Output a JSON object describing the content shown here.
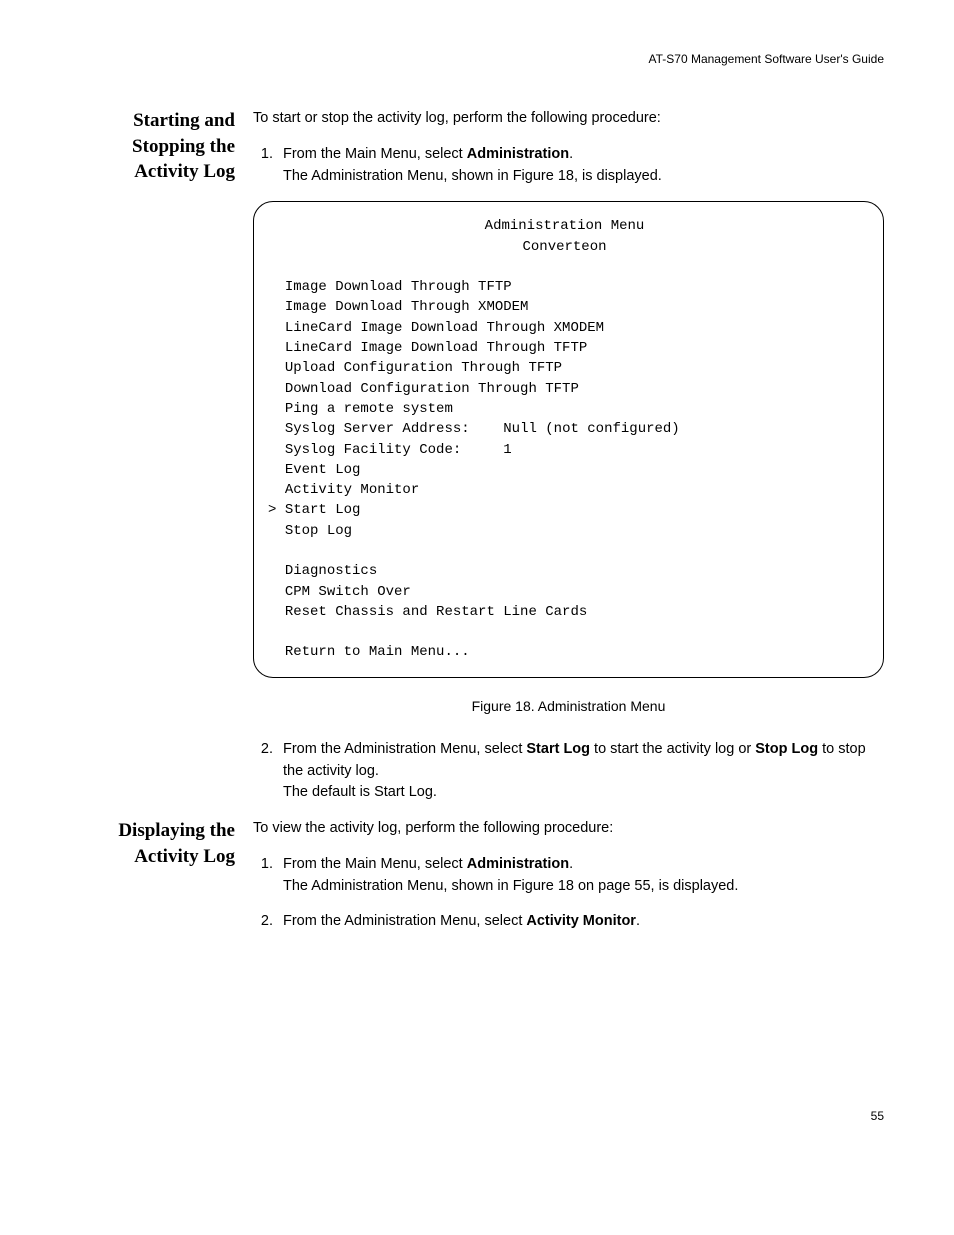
{
  "header": {
    "guide_title": "AT-S70 Management Software User's Guide"
  },
  "section1": {
    "heading": "Starting and Stopping the Activity Log",
    "intro": "To start or stop the activity log, perform the following procedure:",
    "step1_pre": "From the Main Menu, select ",
    "step1_bold": "Administration",
    "step1_post": ".",
    "step1_after": "The Administration Menu, shown in Figure 18, is displayed.",
    "step2_pre": "From the Administration Menu, select ",
    "step2_bold1": "Start Log",
    "step2_mid": " to start the activity log or ",
    "step2_bold2": "Stop Log",
    "step2_post": " to stop the activity log.",
    "step2_after": "The default is Start Log."
  },
  "menu": {
    "title_line1": "Administration Menu",
    "title_line2": "Converteon",
    "item1": "Image Download Through TFTP",
    "item2": "Image Download Through XMODEM",
    "item3": "LineCard Image Download Through XMODEM",
    "item4": "LineCard Image Download Through TFTP",
    "item5": "Upload Configuration Through TFTP",
    "item6": "Download Configuration Through TFTP",
    "item7": "Ping a remote system",
    "item8_label": "Syslog Server Address:",
    "item8_value": "Null (not configured)",
    "item9_label": "Syslog Facility Code:",
    "item9_value": "1",
    "item10": "Event Log",
    "item11": "Activity Monitor",
    "item12": "Start Log",
    "item13": "Stop Log",
    "item14": "Diagnostics",
    "item15": "CPM Switch Over",
    "item16": "Reset Chassis and Restart Line Cards",
    "item17": "Return to Main Menu...",
    "cursor": ">"
  },
  "figure_caption": "Figure 18. Administration Menu",
  "section2": {
    "heading": "Displaying the Activity Log",
    "intro": "To view the activity log, perform the following procedure:",
    "step1_pre": "From the Main Menu, select ",
    "step1_bold": "Administration",
    "step1_post": ".",
    "step1_after": "The Administration Menu, shown in Figure 18 on page 55, is displayed.",
    "step2_pre": "From the Administration Menu, select ",
    "step2_bold": "Activity Monitor",
    "step2_post": "."
  },
  "page_number": "55"
}
